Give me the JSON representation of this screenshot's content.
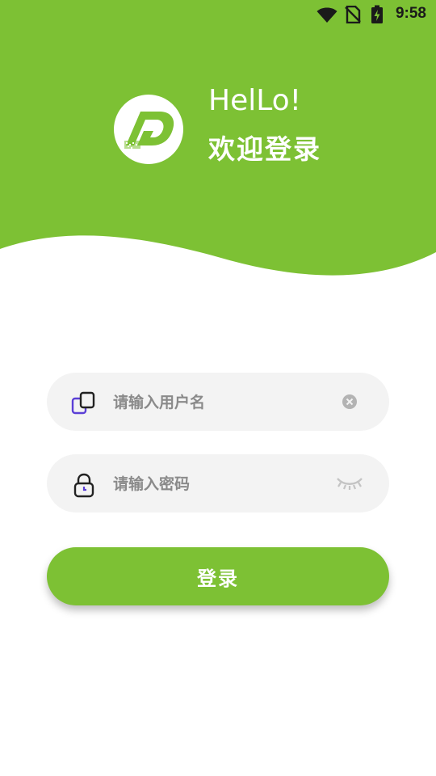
{
  "status_bar": {
    "time": "9:58",
    "icons": [
      "wifi-icon",
      "no-sim-icon",
      "battery-charging-icon"
    ]
  },
  "header": {
    "greeting": "HelLo!",
    "welcome": "欢迎登录",
    "logo_icon": "app-logo",
    "background_color": "#7dc134"
  },
  "form": {
    "username": {
      "value": "",
      "placeholder": "请输入用户名",
      "leading_icon": "copy-icon",
      "trailing_icon": "clear-icon"
    },
    "password": {
      "value": "",
      "placeholder": "请输入密码",
      "leading_icon": "lock-icon",
      "trailing_icon": "eye-closed-icon"
    },
    "login_label": "登录"
  },
  "colors": {
    "accent": "#7dc134",
    "field_bg": "#f3f3f3",
    "icon_purple": "#5b3fd6"
  }
}
